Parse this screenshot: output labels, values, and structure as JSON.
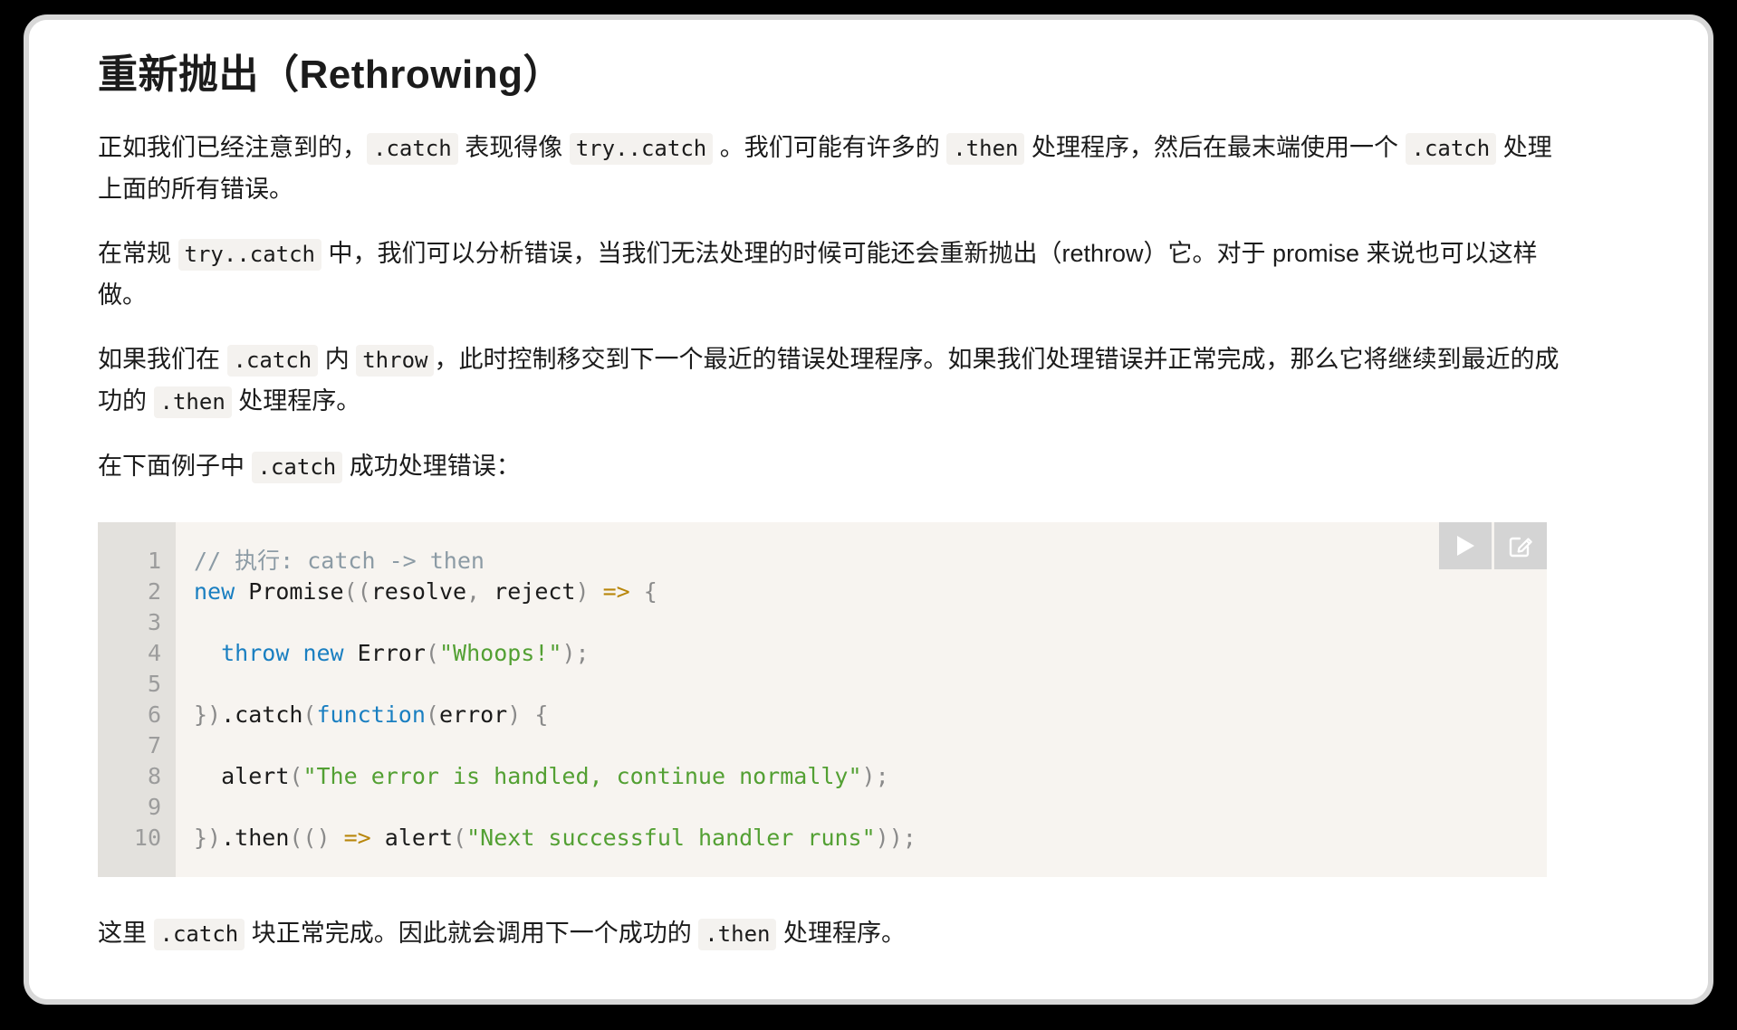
{
  "page": {
    "title": "重新抛出（Rethrowing）"
  },
  "paragraphs": {
    "p1": {
      "seg1": "正如我们已经注意到的，",
      "code1": ".catch",
      "seg2": " 表现得像 ",
      "code2": "try..catch",
      "seg3": " 。我们可能有许多的 ",
      "code3": ".then",
      "seg4": " 处理程序，然后在最末端使用一个 ",
      "code4": ".catch",
      "seg5": " 处理上面的所有错误。"
    },
    "p2": {
      "seg1": "在常规 ",
      "code1": "try..catch",
      "seg2": " 中，我们可以分析错误，当我们无法处理的时候可能还会重新抛出（rethrow）它。对于 promise 来说也可以这样做。"
    },
    "p3": {
      "seg1": "如果我们在 ",
      "code1": ".catch",
      "seg2": " 内 ",
      "code2": "throw",
      "seg3": "，此时控制移交到下一个最近的错误处理程序。如果我们处理错误并正常完成，那么它将继续到最近的成功的 ",
      "code3": ".then",
      "seg4": " 处理程序。"
    },
    "p4": {
      "seg1": "在下面例子中 ",
      "code1": ".catch",
      "seg2": " 成功处理错误："
    },
    "p5": {
      "seg1": "这里 ",
      "code1": ".catch",
      "seg2": " 块正常完成。因此就会调用下一个成功的 ",
      "code2": ".then",
      "seg3": " 处理程序。"
    }
  },
  "code_block": {
    "language": "javascript",
    "line_numbers": "1\n2\n3\n4\n5\n6\n7\n8\n9\n10",
    "line_count": 10,
    "lines": [
      "// 执行: catch -> then",
      "new Promise((resolve, reject) => {",
      "",
      "  throw new Error(\"Whoops!\");",
      "",
      "}).catch(function(error) {",
      "",
      "  alert(\"The error is handled, continue normally\");",
      "",
      "}).then(() => alert(\"Next successful handler runs\"));"
    ],
    "toolbar": {
      "run_button_label": "run-code",
      "edit_button_label": "edit-code"
    }
  },
  "colors": {
    "background": "#ffffff",
    "frame_border": "#d8d8d8",
    "text": "#1b1b1b",
    "inline_code_bg": "#f4f2ef",
    "code_block_bg": "#f7f4f0",
    "gutter_bg": "#e3e1dd",
    "gutter_text": "#9c9c9c",
    "syntax_comment": "#8c9ba5",
    "syntax_keyword": "#1a7fc1",
    "syntax_string": "#53a033",
    "syntax_arrow": "#b8860b",
    "syntax_punct": "#8a8a8a",
    "toolbar_button_bg": "#d4d4d4"
  }
}
